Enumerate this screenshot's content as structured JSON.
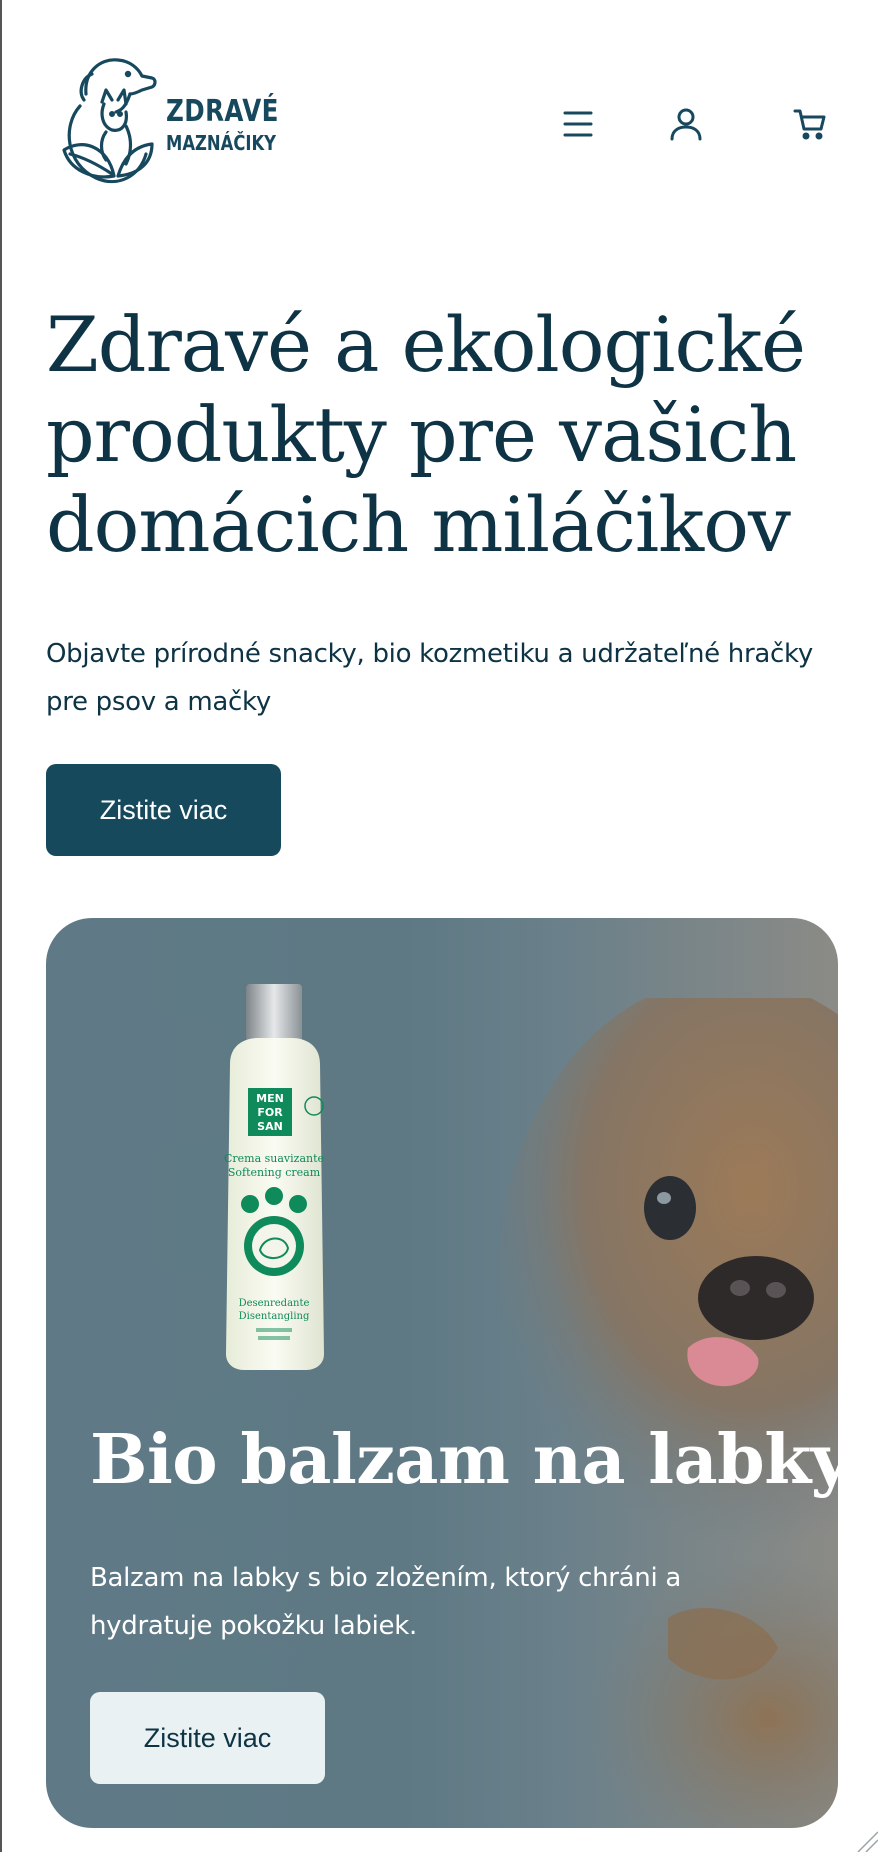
{
  "brand": {
    "name_line1": "ZDRAVÉ",
    "name_line2": "MAZNÁČIKY"
  },
  "header": {
    "icons": [
      "menu-icon",
      "account-icon",
      "cart-icon"
    ]
  },
  "hero": {
    "title": "Zdravé a ekologické produkty pre vašich domácich miláčikov",
    "subtitle": "Objavte prírodné snacky, bio kozmetiku a udržateľné hračky pre psov a mačky",
    "cta_label": "Zistite viac"
  },
  "product_card": {
    "title": "Bio balzam na labky",
    "description": "Balzam na labky s bio zložením, ktorý chráni a hydratuje pokožku labiek.",
    "cta_label": "Zistite viac",
    "bottle_label": {
      "brand": "MEN FOR SAN",
      "line1": "Crema suavizante",
      "line2": "Softening cream",
      "line3": "Desenredante",
      "line4": "Disentangling"
    }
  },
  "colors": {
    "primary": "#16495c",
    "text": "#0d3345",
    "card_overlay": "#5f7a86",
    "secondary_button": "#e9f1f3"
  }
}
